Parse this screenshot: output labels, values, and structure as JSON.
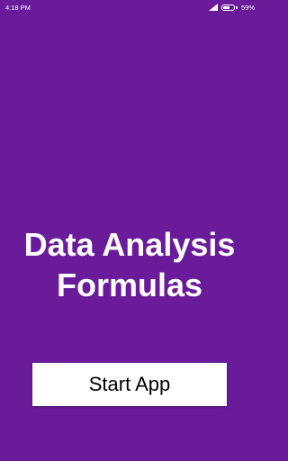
{
  "status_bar": {
    "time": "4:18 PM",
    "battery_percent_label": "59%",
    "battery_level": 0.59,
    "icons": [
      "signal-icon",
      "battery-icon"
    ]
  },
  "main": {
    "title_line1": "Data Analysis",
    "title_line2": "Formulas",
    "start_button_label": "Start App"
  },
  "colors": {
    "background": "#6a1b9a",
    "button_background": "#ffffff",
    "text_on_background": "#ffffff",
    "button_text": "#000000"
  }
}
